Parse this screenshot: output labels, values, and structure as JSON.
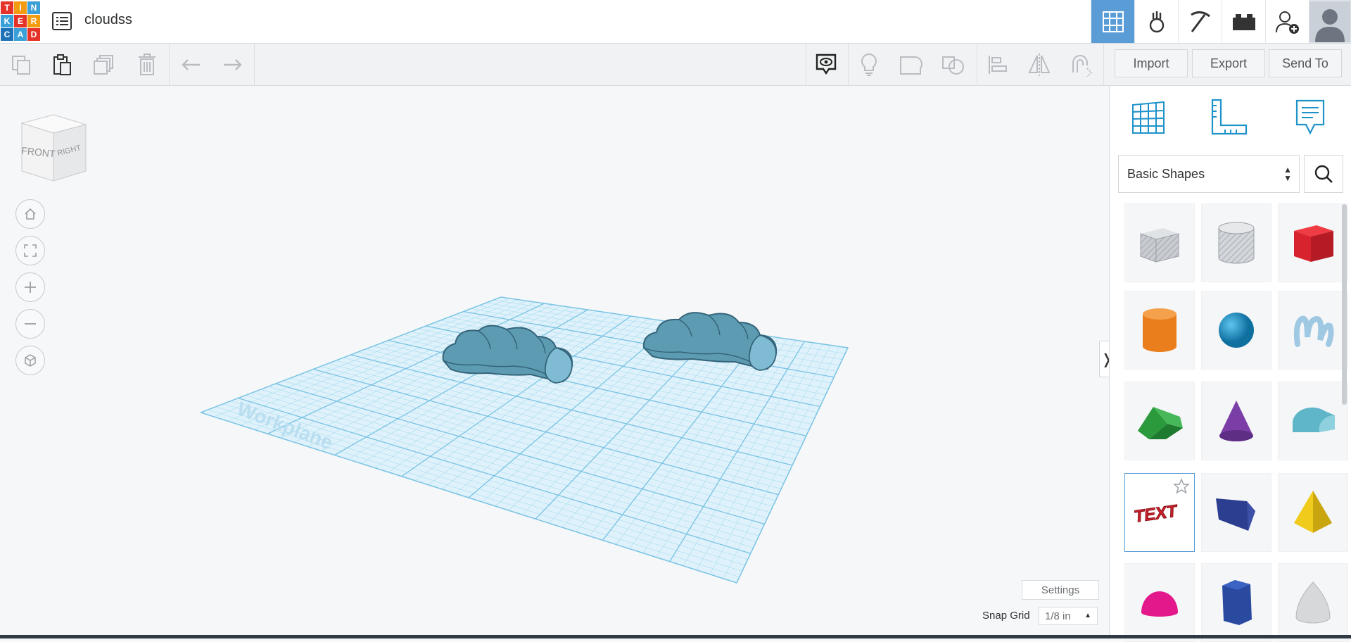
{
  "header": {
    "logo_letters": [
      "T",
      "I",
      "N",
      "K",
      "E",
      "R",
      "C",
      "A",
      "D"
    ],
    "logo_colors": [
      "#e6332a",
      "#f39c12",
      "#3ca0d8",
      "#3ca0d8",
      "#e6332a",
      "#f39c12",
      "#1f72b8",
      "#3ca0d8",
      "#e6332a"
    ],
    "design_title": "cloudss",
    "nav_icons": [
      "3d-view-icon",
      "circuits-icon",
      "minecraft-icon",
      "lego-bricks-icon",
      "invite-user-icon",
      "profile-avatar"
    ]
  },
  "toolbar": {
    "left_icons": [
      "copy-icon",
      "paste-icon",
      "duplicate-icon",
      "delete-icon",
      "undo-icon",
      "redo-icon"
    ],
    "mid_icons": [
      "show-all-icon",
      "notes-icon",
      "group-icon",
      "ungroup-icon",
      "align-icon",
      "mirror-icon",
      "cruise-icon"
    ],
    "import_label": "Import",
    "export_label": "Export",
    "send_label": "Send To"
  },
  "viewport": {
    "viewcube_front": "FRONT",
    "viewcube_right": "RIGHT",
    "view_controls": [
      "home-view-icon",
      "fit-view-icon",
      "zoom-in-icon",
      "zoom-out-icon",
      "ortho-view-icon"
    ],
    "workplane_label": "Workplane",
    "settings_label": "Settings",
    "snap_label": "Snap Grid",
    "snap_value": "1/8 in",
    "collapse_glyph": "❭"
  },
  "panel": {
    "tools": [
      "workplane-icon",
      "ruler-icon",
      "notes-tool-icon"
    ],
    "library_selected": "Basic Shapes",
    "shapes": [
      {
        "name": "box-hole",
        "color": "#b9bec5"
      },
      {
        "name": "cylinder-hole",
        "color": "#c4c8ce"
      },
      {
        "name": "box",
        "color": "#d7232d"
      },
      {
        "name": "cylinder",
        "color": "#ea7d1c"
      },
      {
        "name": "sphere",
        "color": "#1c8fc6"
      },
      {
        "name": "scribble",
        "color": "#a9cfe8"
      },
      {
        "name": "roof",
        "color": "#2a9a3c"
      },
      {
        "name": "cone",
        "color": "#7a3ea6"
      },
      {
        "name": "round-roof",
        "color": "#5fb6c9"
      },
      {
        "name": "text",
        "color": "#c8212c",
        "label": "TEXT"
      },
      {
        "name": "wedge",
        "color": "#2c3e8f"
      },
      {
        "name": "pyramid",
        "color": "#f0cb1c"
      },
      {
        "name": "half-sphere",
        "color": "#e3188a"
      },
      {
        "name": "polygon",
        "color": "#2a4aa0"
      },
      {
        "name": "paraboloid",
        "color": "#d6d8da"
      }
    ]
  }
}
